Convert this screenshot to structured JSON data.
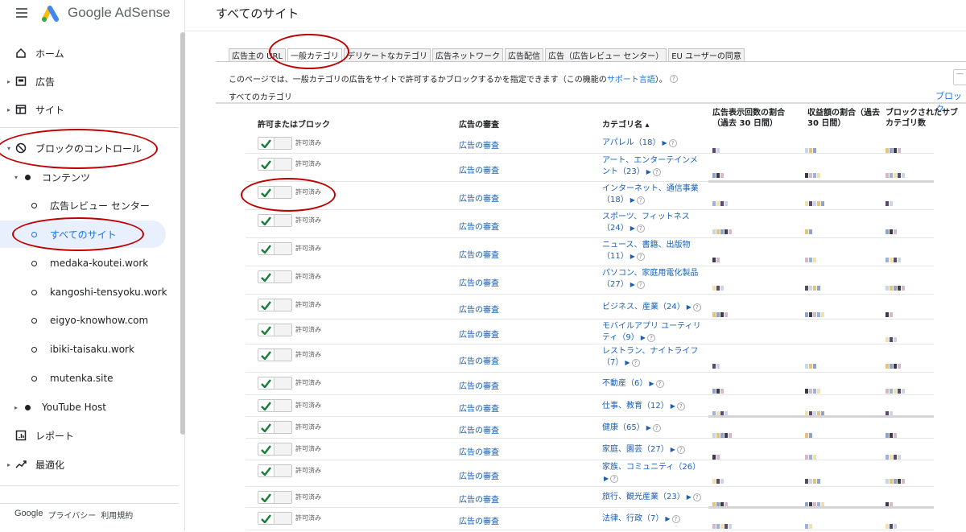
{
  "app": {
    "brand_name": "Google AdSense",
    "page_title": "すべてのサイト"
  },
  "sidebar": {
    "items": [
      {
        "label": "ホーム",
        "icon": "home-icon"
      },
      {
        "label": "広告",
        "icon": "ads-icon"
      },
      {
        "label": "サイト",
        "icon": "sites-icon"
      },
      {
        "label": "ブロックのコントロール",
        "icon": "block-icon"
      },
      {
        "label": "コンテンツ"
      },
      {
        "label": "広告レビュー センター"
      },
      {
        "label": "すべてのサイト"
      },
      {
        "label": "medaka-koutei.work"
      },
      {
        "label": "kangoshi-tensyoku.work"
      },
      {
        "label": "eigyo-knowhow.com"
      },
      {
        "label": "ibiki-taisaku.work"
      },
      {
        "label": "mutenka.site"
      },
      {
        "label": "YouTube Host"
      },
      {
        "label": "レポート",
        "icon": "reports-icon"
      },
      {
        "label": "最適化",
        "icon": "optimize-icon"
      }
    ],
    "footer": {
      "google": "Google",
      "privacy": "プライバシー",
      "terms": "利用規約"
    }
  },
  "tabs": [
    {
      "label": "広告主の URL"
    },
    {
      "label": "一般カテゴリ",
      "selected": true
    },
    {
      "label": "デリケートなカテゴリ"
    },
    {
      "label": "広告ネットワーク"
    },
    {
      "label": "広告配信"
    },
    {
      "label": "広告（広告レビュー センター）"
    },
    {
      "label": "EU ユーザーの同意"
    }
  ],
  "description": {
    "text": "このページでは、一般カテゴリの広告をサイトで許可するかブロックするかを指定できます（この機能の",
    "link": "サポート言語",
    "suffix": "）。",
    "all_categories": "すべてのカテゴリ",
    "block_link": "ブロック"
  },
  "table": {
    "headers": {
      "allow_block": "許可またはブロック",
      "review": "広告の審査",
      "category": "カテゴリ名 ▴",
      "impressions": "広告表示回数の割合（過去 30 日間）",
      "revenue": "収益額の割合（過去 30 日間）",
      "blocked_sub": "ブロックされたサブカテゴリ数"
    },
    "rows": [
      {
        "status": "許可済み",
        "review": "広告の審査",
        "category": "アパレル（18）"
      },
      {
        "status": "許可済み",
        "review": "広告の審査",
        "category": "アート、エンターテインメント（23）"
      },
      {
        "status": "許可済み",
        "review": "広告の審査",
        "category": "インターネット、通信事業（18）"
      },
      {
        "status": "許可済み",
        "review": "広告の審査",
        "category": "スポーツ、フィットネス（24）"
      },
      {
        "status": "許可済み",
        "review": "広告の審査",
        "category": "ニュース、書籍、出版物（11）"
      },
      {
        "status": "許可済み",
        "review": "広告の審査",
        "category": "パソコン、家庭用電化製品（27）"
      },
      {
        "status": "許可済み",
        "review": "広告の審査",
        "category": "ビジネス、産業（24）"
      },
      {
        "status": "許可済み",
        "review": "広告の審査",
        "category": "モバイルアプリ ユーティリティ（9）"
      },
      {
        "status": "許可済み",
        "review": "広告の審査",
        "category": "レストラン、ナイトライフ（7）"
      },
      {
        "status": "許可済み",
        "review": "広告の審査",
        "category": "不動産（6）"
      },
      {
        "status": "許可済み",
        "review": "広告の審査",
        "category": "仕事、教育（12）"
      },
      {
        "status": "許可済み",
        "review": "広告の審査",
        "category": "健康（65）"
      },
      {
        "status": "許可済み",
        "review": "広告の審査",
        "category": "家庭、園芸（27）"
      },
      {
        "status": "許可済み",
        "review": "広告の審査",
        "category": "家族、コミュニティ（26）"
      },
      {
        "status": "許可済み",
        "review": "広告の審査",
        "category": "旅行、観光産業（23）"
      },
      {
        "status": "許可済み",
        "review": "広告の審査",
        "category": "法律、行政（7）"
      }
    ]
  },
  "colors": {
    "accent": "#1a73e8",
    "check": "#188038",
    "annotation": "#c00000"
  }
}
